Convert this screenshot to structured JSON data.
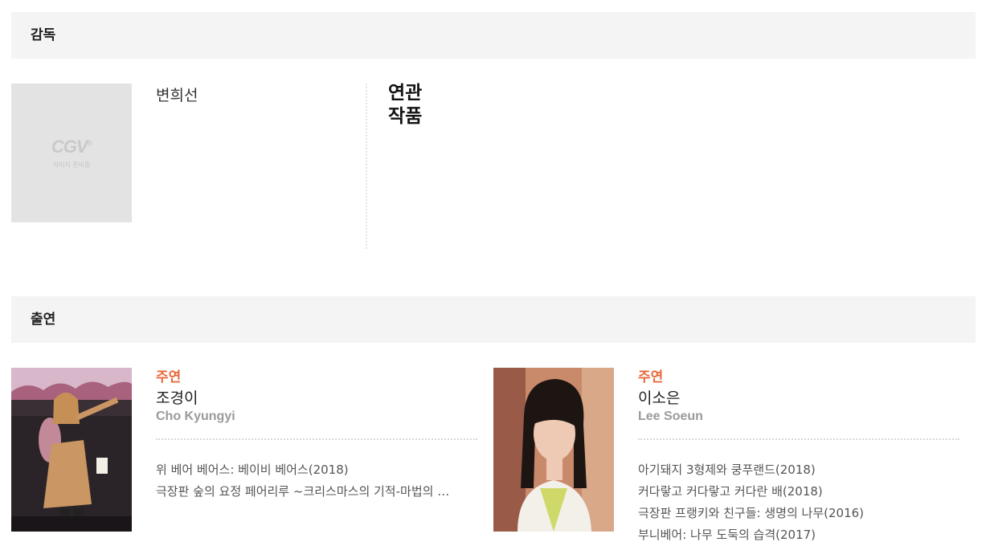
{
  "director_section": {
    "header": "감독",
    "placeholder_logo": "CGV",
    "placeholder_text": "이미지 준비중",
    "name": "변희선",
    "related_title": "연관 작품"
  },
  "cast_section": {
    "header": "출연",
    "members": [
      {
        "role": "주연",
        "name_ko": "조경이",
        "name_en": "Cho Kyungyi",
        "works": [
          "위 베어 베어스: 베이비 베어스(2018)",
          "극장판 숲의 요정 페어리루 ~크리스마스의 기적-마법의 …"
        ]
      },
      {
        "role": "주연",
        "name_ko": "이소은",
        "name_en": "Lee Soeun",
        "works": [
          "아기돼지 3형제와 쿵푸랜드(2018)",
          "커다랗고 커다랗고 커다란 배(2018)",
          "극장판 프랭키와 친구들: 생명의 나무(2016)",
          "부니베어: 나무 도둑의 습격(2017)"
        ]
      }
    ]
  }
}
